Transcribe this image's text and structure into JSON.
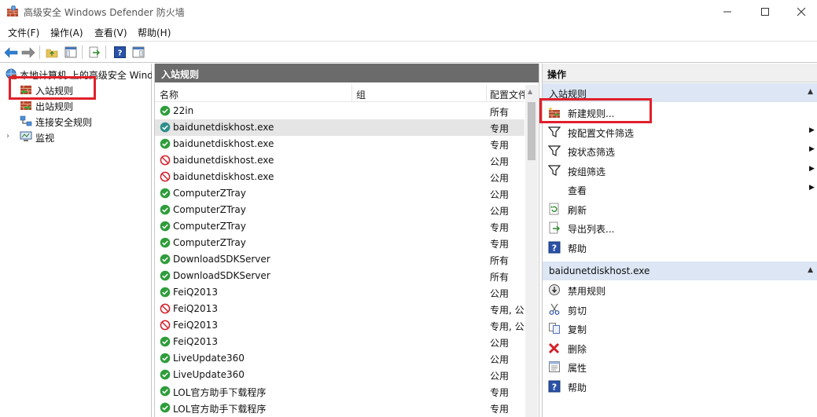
{
  "window": {
    "title": "高级安全 Windows Defender 防火墙"
  },
  "menu": [
    {
      "label": "文件(F)"
    },
    {
      "label": "操作(A)"
    },
    {
      "label": "查看(V)"
    },
    {
      "label": "帮助(H)"
    }
  ],
  "tree": {
    "root": "本地计算机 上的高级安全 Windows Defender 防火墙",
    "items": [
      {
        "label": "入站规则"
      },
      {
        "label": "出站规则"
      },
      {
        "label": "连接安全规则"
      },
      {
        "label": "监视"
      }
    ]
  },
  "middle": {
    "title": "入站规则",
    "columns": [
      "名称",
      "组",
      "配置文件"
    ],
    "rows": [
      {
        "name": "22in",
        "profile": "所有",
        "status": "allow"
      },
      {
        "name": "baidunetdiskhost.exe",
        "profile": "专用",
        "status": "allow-selected"
      },
      {
        "name": "baidunetdiskhost.exe",
        "profile": "专用",
        "status": "allow"
      },
      {
        "name": "baidunetdiskhost.exe",
        "profile": "公用",
        "status": "block"
      },
      {
        "name": "baidunetdiskhost.exe",
        "profile": "公用",
        "status": "block"
      },
      {
        "name": "ComputerZTray",
        "profile": "公用",
        "status": "allow"
      },
      {
        "name": "ComputerZTray",
        "profile": "公用",
        "status": "allow"
      },
      {
        "name": "ComputerZTray",
        "profile": "专用",
        "status": "allow"
      },
      {
        "name": "ComputerZTray",
        "profile": "专用",
        "status": "allow"
      },
      {
        "name": "DownloadSDKServer",
        "profile": "所有",
        "status": "allow"
      },
      {
        "name": "DownloadSDKServer",
        "profile": "所有",
        "status": "allow"
      },
      {
        "name": "FeiQ2013",
        "profile": "公用",
        "status": "allow"
      },
      {
        "name": "FeiQ2013",
        "profile": "专用, 公",
        "status": "block"
      },
      {
        "name": "FeiQ2013",
        "profile": "专用, 公",
        "status": "block"
      },
      {
        "name": "FeiQ2013",
        "profile": "公用",
        "status": "allow"
      },
      {
        "name": "LiveUpdate360",
        "profile": "公用",
        "status": "allow"
      },
      {
        "name": "LiveUpdate360",
        "profile": "公用",
        "status": "allow"
      },
      {
        "name": "LOL官方助手下载程序",
        "profile": "专用",
        "status": "allow"
      },
      {
        "name": "LOL官方助手下载程序",
        "profile": "专用",
        "status": "allow"
      }
    ]
  },
  "actions": {
    "title": "操作",
    "section1": {
      "title": "入站规则",
      "items": [
        {
          "label": "新建规则...",
          "icon": "new-rule-icon"
        },
        {
          "label": "按配置文件筛选",
          "icon": "filter-icon",
          "submenu": true
        },
        {
          "label": "按状态筛选",
          "icon": "filter-icon",
          "submenu": true
        },
        {
          "label": "按组筛选",
          "icon": "filter-icon",
          "submenu": true
        },
        {
          "label": "查看",
          "icon": "",
          "submenu": true
        },
        {
          "label": "刷新",
          "icon": "refresh-icon"
        },
        {
          "label": "导出列表...",
          "icon": "export-icon"
        },
        {
          "label": "帮助",
          "icon": "help-icon"
        }
      ]
    },
    "section2": {
      "title": "baidunetdiskhost.exe",
      "items": [
        {
          "label": "禁用规则",
          "icon": "disable-icon"
        },
        {
          "label": "剪切",
          "icon": "cut-icon"
        },
        {
          "label": "复制",
          "icon": "copy-icon"
        },
        {
          "label": "删除",
          "icon": "delete-icon"
        },
        {
          "label": "属性",
          "icon": "properties-icon"
        },
        {
          "label": "帮助",
          "icon": "help-icon"
        }
      ]
    }
  },
  "colors": {
    "allow": "#2e9d3a",
    "block": "#d4202a",
    "highlight": "#e0202a",
    "section": "#dce6f4"
  }
}
